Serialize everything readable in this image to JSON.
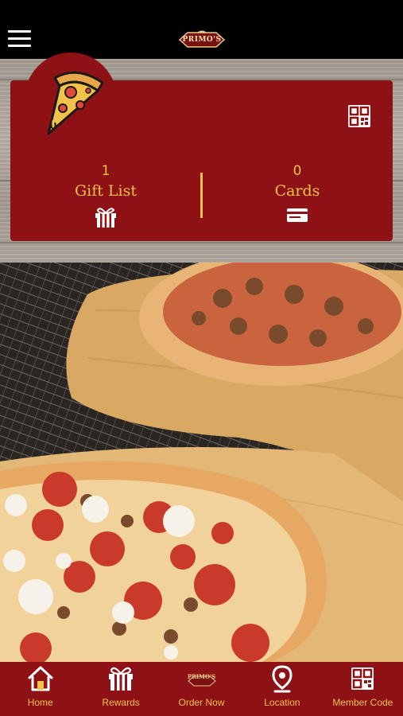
{
  "header": {
    "menu_icon": "hamburger-menu-icon",
    "logo_text": "PRIMO'S"
  },
  "card": {
    "pizza_icon": "pizza-slice-icon",
    "qr_icon": "qr-code-icon",
    "gift_list": {
      "count": "1",
      "label": "Gift List",
      "icon": "gift-icon"
    },
    "cards": {
      "count": "0",
      "label": "Cards",
      "icon": "credit-card-icon"
    }
  },
  "hero": {
    "icon": "pizza-photo"
  },
  "bottom_nav": {
    "items": [
      {
        "label": "Home",
        "icon": "home-icon"
      },
      {
        "label": "Rewards",
        "icon": "gift-icon"
      },
      {
        "label": "Order Now",
        "icon": "primos-logo-icon",
        "logo_text": "PRIMO'S"
      },
      {
        "label": "Location",
        "icon": "location-pin-icon"
      },
      {
        "label": "Member Code",
        "icon": "qr-code-icon"
      }
    ]
  },
  "colors": {
    "brand_red": "#8e1215",
    "accent_gold": "#f0c24a",
    "topbar": "#000000"
  }
}
